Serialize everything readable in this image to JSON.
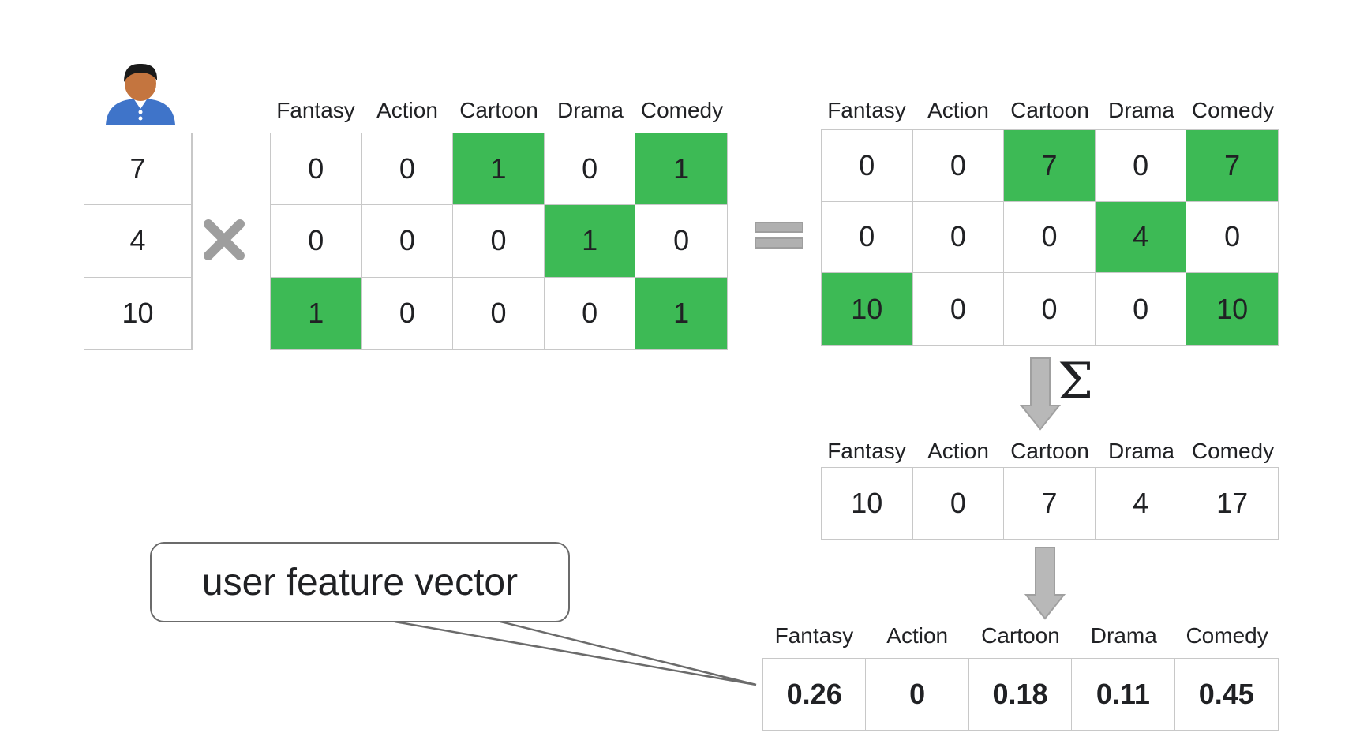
{
  "user_ratings": [
    "7",
    "4",
    "10"
  ],
  "genres": [
    "Fantasy",
    "Action",
    "Cartoon",
    "Drama",
    "Comedy"
  ],
  "movie_matrix": [
    [
      "0",
      "0",
      "1",
      "0",
      "1"
    ],
    [
      "0",
      "0",
      "0",
      "1",
      "0"
    ],
    [
      "1",
      "0",
      "0",
      "0",
      "1"
    ]
  ],
  "weighted_matrix": [
    [
      "0",
      "0",
      "7",
      "0",
      "7"
    ],
    [
      "0",
      "0",
      "0",
      "4",
      "0"
    ],
    [
      "10",
      "0",
      "0",
      "0",
      "10"
    ]
  ],
  "sum_symbol": "Σ",
  "sum_row": [
    "10",
    "0",
    "7",
    "4",
    "17"
  ],
  "normalized_row": [
    "0.26",
    "0",
    "0.18",
    "0.11",
    "0.45"
  ],
  "callout_label": "user feature vector",
  "colors": {
    "highlight": "#3dba55",
    "arrow": "#b8b8b8"
  },
  "icons": {
    "user": "person-avatar-icon",
    "multiply": "multiply-icon",
    "equals": "equals-icon"
  }
}
